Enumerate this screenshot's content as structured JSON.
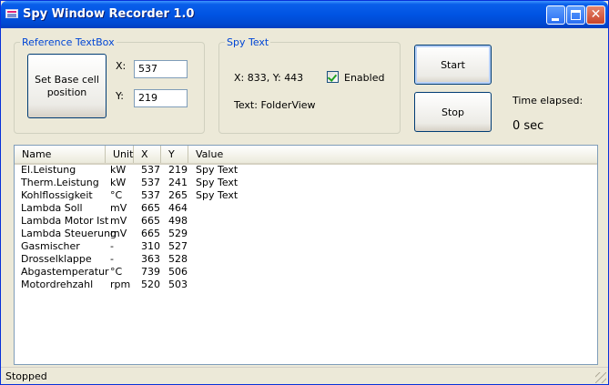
{
  "window": {
    "title": "Spy Window Recorder 1.0"
  },
  "reference": {
    "legend": "Reference TextBox",
    "set_base_label": "Set Base cell position",
    "x_label": "X:",
    "x_value": "537",
    "y_label": "Y:",
    "y_value": "219"
  },
  "spy": {
    "legend": "Spy Text",
    "coords": "X: 833, Y: 443",
    "enabled_label": "Enabled",
    "enabled_checked": true,
    "text": "Text: FolderView"
  },
  "controls": {
    "start_label": "Start",
    "stop_label": "Stop",
    "time_label": "Time elapsed:",
    "time_value": "0 sec"
  },
  "list": {
    "columns": [
      "Name",
      "Unit",
      "X",
      "Y",
      "Value"
    ],
    "rows": [
      [
        "El.Leistung",
        "kW",
        "537",
        "219",
        "Spy Text"
      ],
      [
        "Therm.Leistung",
        "kW",
        "537",
        "241",
        "Spy Text"
      ],
      [
        "Kohlflossigkeit",
        "°C",
        "537",
        "265",
        "Spy Text"
      ],
      [
        "Lambda Soll",
        "mV",
        "665",
        "464",
        ""
      ],
      [
        "Lambda Motor Ist",
        "mV",
        "665",
        "498",
        ""
      ],
      [
        "Lambda Steuerung",
        "mV",
        "665",
        "529",
        ""
      ],
      [
        "Gasmischer",
        "-",
        "310",
        "527",
        ""
      ],
      [
        "Drosselklappe",
        "-",
        "363",
        "528",
        ""
      ],
      [
        "Abgastemperatur",
        "°C",
        "739",
        "506",
        ""
      ],
      [
        "Motordrehzahl",
        "rpm",
        "520",
        "503",
        ""
      ]
    ]
  },
  "status": {
    "text": "Stopped"
  },
  "icons": {
    "app": "app-window-icon",
    "minimize": "minimize-icon",
    "maximize": "maximize-icon",
    "close": "close-icon",
    "check": "checkmark-icon",
    "grip": "resize-grip-icon"
  },
  "colors": {
    "titlebar": "#0054e3",
    "group_legend": "#0046d5",
    "window_bg": "#ece9d8",
    "button_border": "#003c74",
    "checkmark": "#21a121"
  }
}
